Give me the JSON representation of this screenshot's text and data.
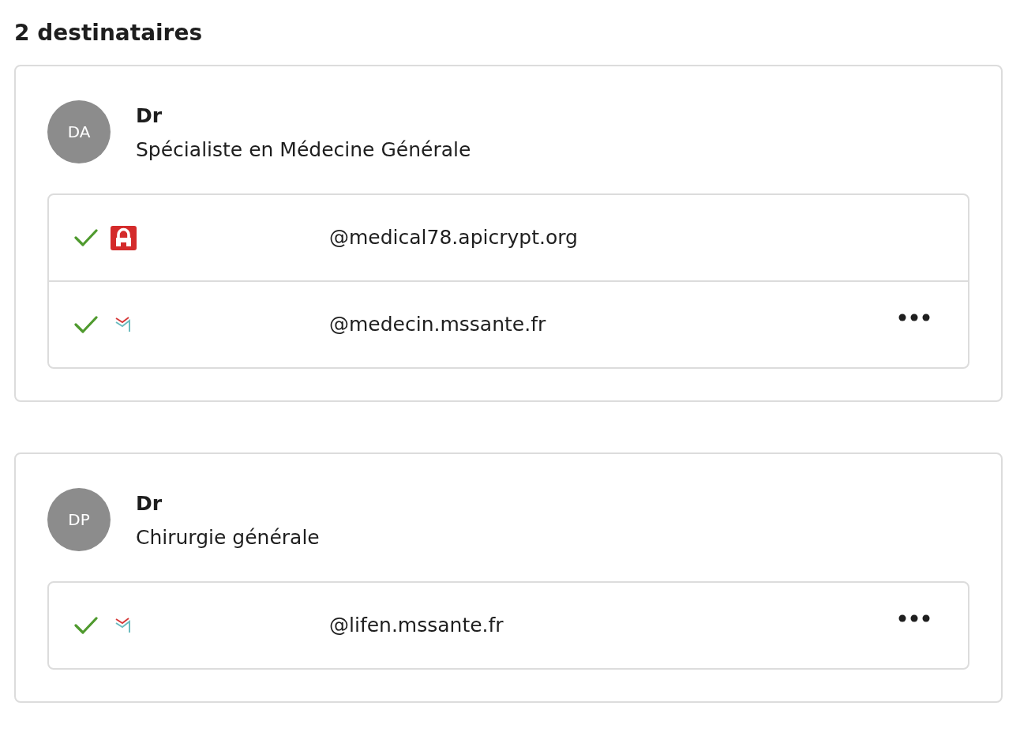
{
  "heading": "2 destinataires",
  "recipients": [
    {
      "initials": "DA",
      "title": "Dr",
      "specialty": "Spécialiste en Médecine Générale",
      "addresses": [
        {
          "kind": "lock",
          "verified": true,
          "address": "@medical78.apicrypt.org",
          "more_menu": false
        },
        {
          "kind": "mail",
          "verified": true,
          "address": "@medecin.mssante.fr",
          "more_menu": true
        }
      ]
    },
    {
      "initials": "DP",
      "title": "Dr",
      "specialty": "Chirurgie générale",
      "addresses": [
        {
          "kind": "mail",
          "verified": true,
          "address": "@lifen.mssante.fr",
          "more_menu": true
        }
      ]
    }
  ]
}
